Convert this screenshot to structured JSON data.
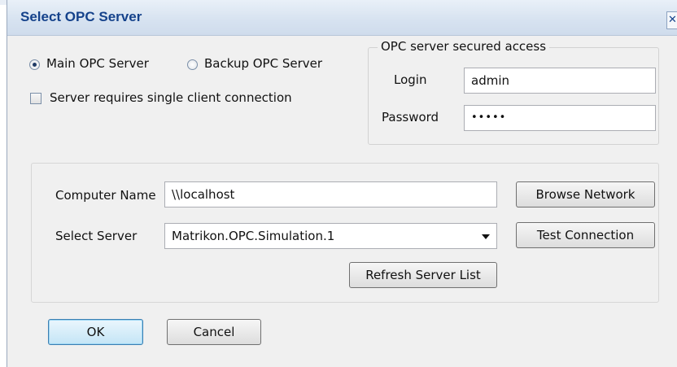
{
  "window": {
    "title": "Select OPC Server",
    "close_glyph": "✕"
  },
  "server_mode": {
    "main_label": "Main OPC Server",
    "backup_label": "Backup OPC Server",
    "selected": "main"
  },
  "single_client": {
    "label": "Server requires single client connection",
    "checked": false
  },
  "secured_access": {
    "legend": "OPC server secured access",
    "login_label": "Login",
    "login_value": "admin",
    "password_label": "Password",
    "password_value": "•••••"
  },
  "connection": {
    "computer_name_label": "Computer Name",
    "computer_name_value": "\\\\localhost",
    "select_server_label": "Select Server",
    "select_server_value": "Matrikon.OPC.Simulation.1",
    "browse_network_label": "Browse Network",
    "test_connection_label": "Test Connection",
    "refresh_list_label": "Refresh Server List"
  },
  "footer": {
    "ok_label": "OK",
    "cancel_label": "Cancel"
  },
  "icons": {
    "close": "close-icon",
    "dropdown": "chevron-down-icon"
  }
}
